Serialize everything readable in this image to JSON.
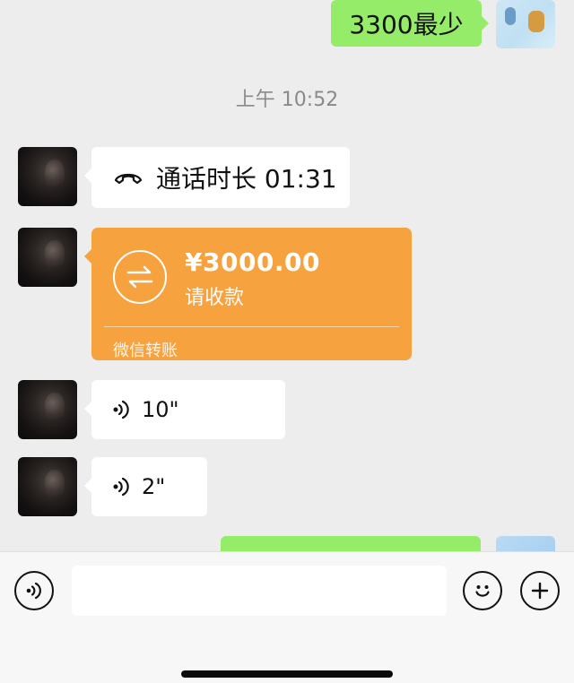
{
  "messages": {
    "outgoing_top": {
      "text": "3300最少"
    },
    "timestamp": "上午 10:52",
    "call": {
      "label": "通话时长 01:31",
      "icon": "phone-hangup-icon"
    },
    "transfer": {
      "amount": "¥3000.00",
      "subtitle": "请收款",
      "footer": "微信转账",
      "color": "#f6a23f"
    },
    "voice_1": {
      "duration": "10\""
    },
    "voice_2": {
      "duration": "2\""
    }
  },
  "input_bar": {
    "left_icon": "voice-input-icon",
    "placeholder": "",
    "emoji_icon": "emoji-icon",
    "plus_icon": "plus-icon"
  },
  "colors": {
    "background": "#ededed",
    "outgoing_bubble": "#95ec69",
    "incoming_bubble": "#ffffff",
    "transfer": "#f6a23f"
  }
}
